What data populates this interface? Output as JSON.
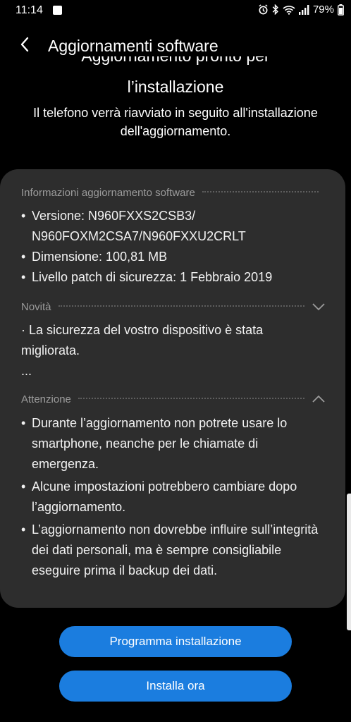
{
  "status_bar": {
    "time": "11:14",
    "battery": "79%",
    "icons": [
      "alarm-icon",
      "bluetooth-icon",
      "wifi-icon",
      "signal-icon"
    ]
  },
  "header": {
    "title": "Aggiornamenti software"
  },
  "headline": {
    "line1": "Aggiornamento pronto per",
    "line2": "l’installazione"
  },
  "subtext": "Il telefono verrà riavviato in seguito all'installazione dell'aggiornamento.",
  "info_section": {
    "title": "Informazioni aggiornamento software",
    "items": [
      "Versione: N960FXXS2CSB3/ N960FOXM2CSA7/N960FXXU2CRLT",
      "Dimensione: 100,81 MB",
      "Livello patch di sicurezza: 1 Febbraio 2019"
    ]
  },
  "news_section": {
    "title": "Novità",
    "text": "· La sicurezza del vostro dispositivo è stata migliorata.",
    "more": "..."
  },
  "warning_section": {
    "title": "Attenzione",
    "items": [
      "Durante l’aggiornamento non potrete usare lo smartphone, neanche per le chiamate di emergenza.",
      "Alcune impostazioni potrebbero cambiare dopo l’aggiornamento.",
      "L’aggiornamento non dovrebbe influire sull’integrità dei dati personali, ma è sempre consigliabile eseguire prima il backup dei dati."
    ]
  },
  "buttons": {
    "schedule": "Programma installazione",
    "install_now": "Installa ora"
  },
  "colors": {
    "accent": "#1b7ddf",
    "card": "#2d2d2d",
    "section_title": "#9c9c9c"
  }
}
